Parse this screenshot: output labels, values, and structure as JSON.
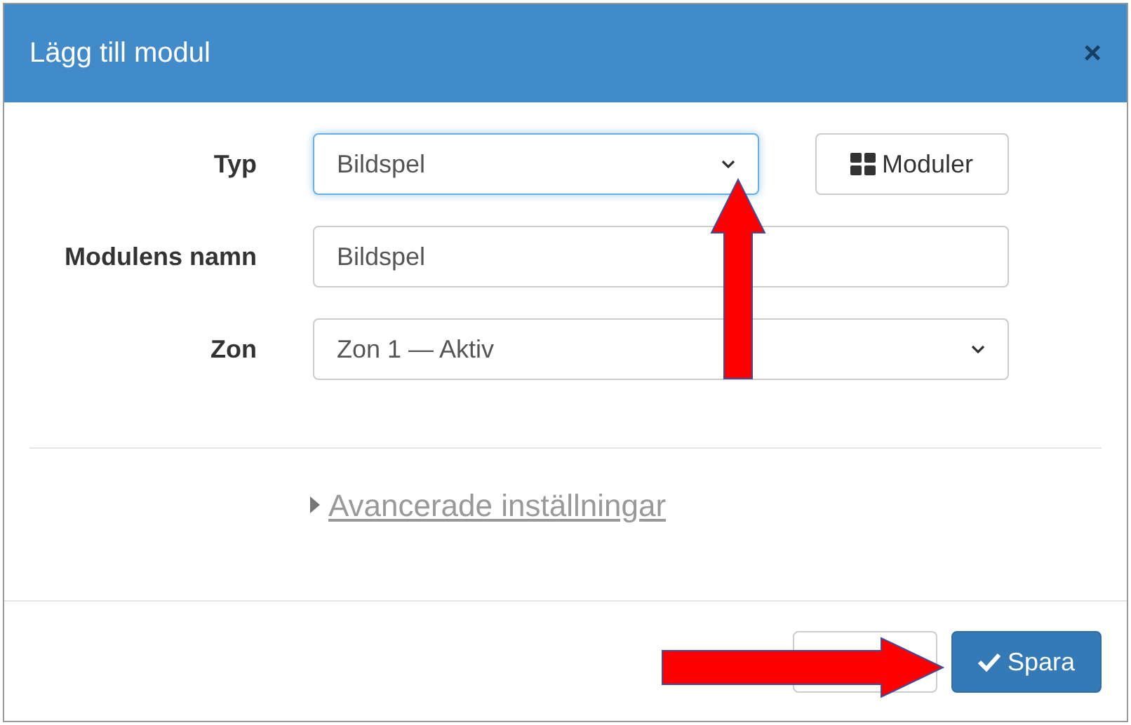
{
  "dialog": {
    "title": "Lägg till modul",
    "close": "×"
  },
  "fields": [
    {
      "label": "Typ",
      "kind": "select",
      "value": "Bildspel",
      "focused": true
    },
    {
      "label": "Modulens namn",
      "kind": "input",
      "value": "Bildspel",
      "focused": false
    },
    {
      "label": "Zon",
      "kind": "select",
      "value": "Zon 1 — Aktiv",
      "focused": false
    }
  ],
  "modules_button": {
    "label": "Moduler"
  },
  "advanced_link": {
    "label": "Avancerade inställningar",
    "expanded": false
  },
  "footer_buttons": [
    {
      "kind": "default"
    },
    {
      "kind": "primary",
      "label": "Spara"
    }
  ],
  "annotations": [
    {
      "kind": "arrow"
    },
    {
      "kind": "arrow"
    }
  ]
}
